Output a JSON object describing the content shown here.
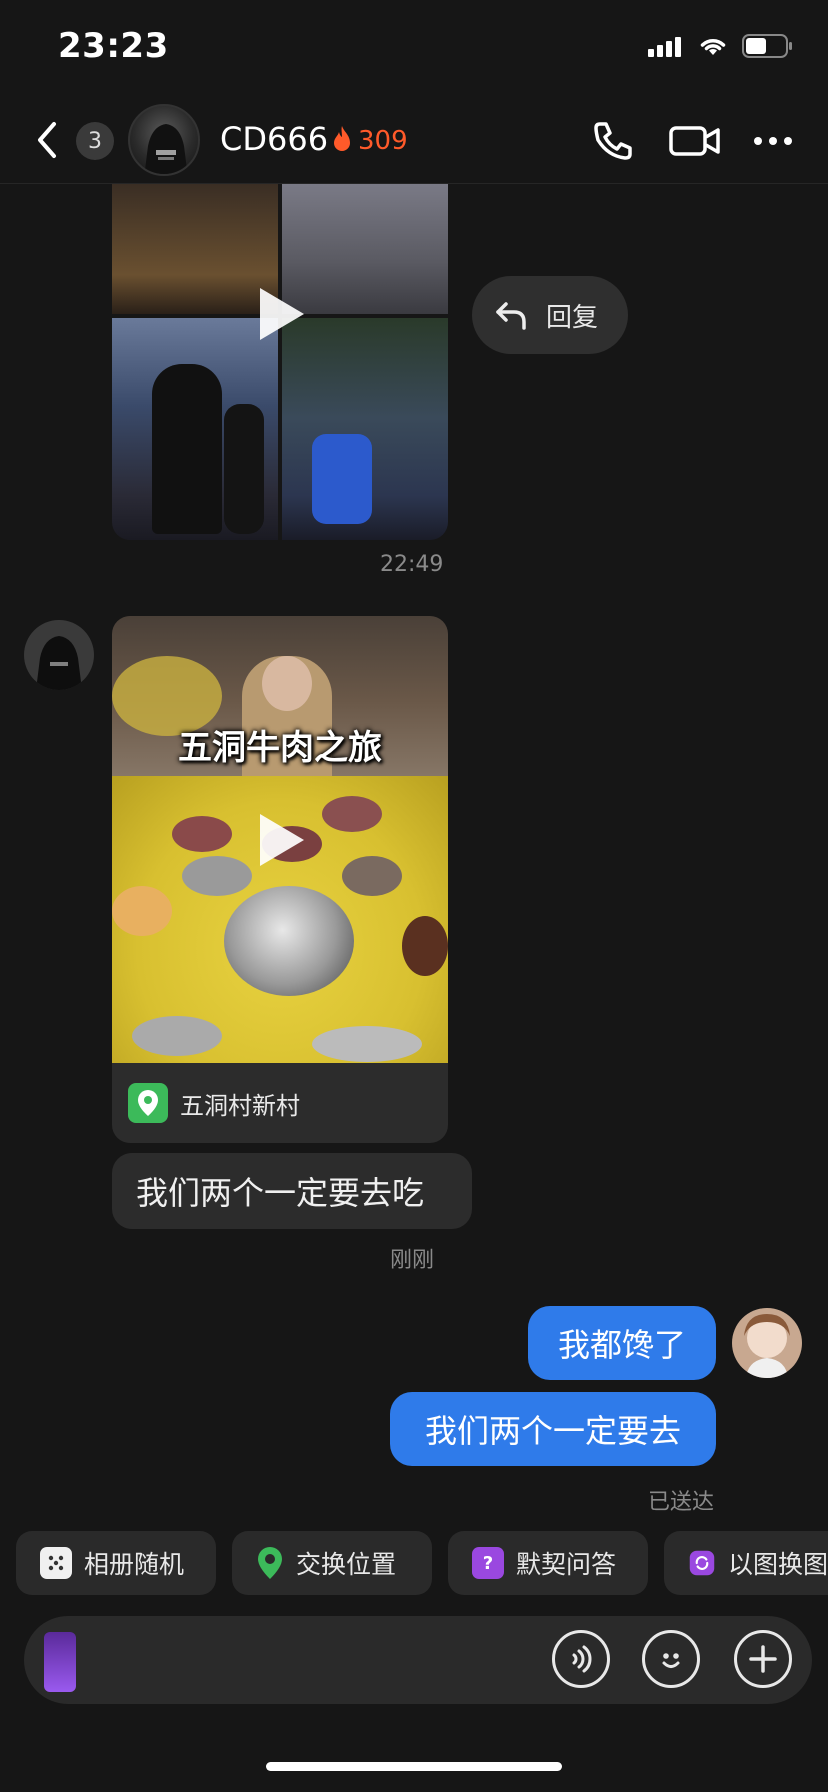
{
  "status_bar": {
    "time": "23:23"
  },
  "header": {
    "unread_count": "3",
    "contact_name": "CD666",
    "streak_count": "309",
    "icons": [
      "back-chevron-icon",
      "phone-icon",
      "video-camera-icon",
      "more-icon"
    ]
  },
  "messages": {
    "first_video": {
      "time": "22:49"
    },
    "reply_action": {
      "label": "回复",
      "icon": "reply-arrow-icon"
    },
    "second_video": {
      "caption": "五洞牛肉之旅",
      "location": "五洞村新村",
      "location_icon": "map-pin-icon"
    },
    "incoming_text": "我们两个一定要去吃",
    "incoming_time": "刚刚",
    "outgoing": [
      {
        "text": "我都馋了"
      },
      {
        "text": "我们两个一定要去"
      }
    ],
    "delivery_status": "已送达"
  },
  "quick_actions": [
    {
      "label": "相册随机",
      "icon": "dice-icon"
    },
    {
      "label": "交换位置",
      "icon": "location-pin-icon"
    },
    {
      "label": "默契问答",
      "icon": "question-icon"
    },
    {
      "label": "以图换图",
      "icon": "swap-image-icon"
    }
  ],
  "input_bar": {
    "icons": [
      "voice-icon",
      "emoji-icon",
      "plus-icon"
    ]
  },
  "colors": {
    "background": "#161616",
    "outgoing_bubble": "#2f7bea",
    "incoming_bubble": "#2c2c2c",
    "streak": "#ff5a2a",
    "location_green": "#3cba5a"
  }
}
